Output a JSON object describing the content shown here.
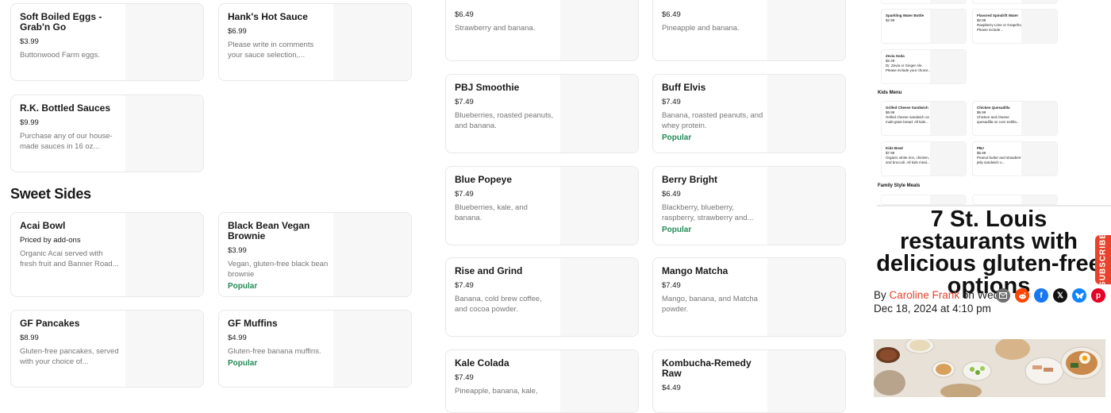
{
  "left_column": {
    "items": [
      {
        "name": "Soft Boiled Eggs - Grab'n Go",
        "price": "$3.99",
        "desc": "Buttonwood Farm eggs.",
        "popular": ""
      },
      {
        "name": "Hank's Hot Sauce",
        "price": "$6.99",
        "desc": "Please write in comments your sauce selection,...",
        "popular": ""
      },
      {
        "name": "R.K. Bottled Sauces",
        "price": "$9.99",
        "desc": "Purchase any of our house-made sauces in 16 oz...",
        "popular": ""
      }
    ],
    "section_title": "Sweet Sides",
    "sweet_sides": [
      {
        "name": "Acai Bowl",
        "price": "Priced by add-ons",
        "desc": "Organic Acai served with fresh fruit and Banner Road...",
        "popular": ""
      },
      {
        "name": "Black Bean Vegan Brownie",
        "price": "$3.99",
        "desc": "Vegan, gluten-free black bean brownie",
        "popular": "Popular"
      },
      {
        "name": "GF Pancakes",
        "price": "$8.99",
        "desc": "Gluten-free pancakes, served with your choice of...",
        "popular": ""
      },
      {
        "name": "GF Muffins",
        "price": "$4.99",
        "desc": "Gluten-free banana muffins.",
        "popular": "Popular"
      }
    ]
  },
  "middle_column": {
    "items": [
      {
        "name": "",
        "price": "$6.49",
        "desc": "Strawberry and banana.",
        "popular": ""
      },
      {
        "name": "",
        "price": "$6.49",
        "desc": "Pineapple and banana.",
        "popular": ""
      },
      {
        "name": "PBJ Smoothie",
        "price": "$7.49",
        "desc": "Blueberries, roasted peanuts, and banana.",
        "popular": ""
      },
      {
        "name": "Buff Elvis",
        "price": "$7.49",
        "desc": "Banana, roasted peanuts, and whey protein.",
        "popular": "Popular"
      },
      {
        "name": "Blue Popeye",
        "price": "$7.49",
        "desc": "Blueberries, kale, and banana.",
        "popular": ""
      },
      {
        "name": "Berry Bright",
        "price": "$6.49",
        "desc": "Blackberry, blueberry, raspberry, strawberry and...",
        "popular": "Popular"
      },
      {
        "name": "Rise and Grind",
        "price": "$7.49",
        "desc": "Banana, cold brew coffee, and cocoa powder.",
        "popular": ""
      },
      {
        "name": "Mango Matcha",
        "price": "$7.49",
        "desc": "Mango, banana, and Matcha powder.",
        "popular": ""
      },
      {
        "name": "Kale Colada",
        "price": "$7.49",
        "desc": "Pineapple, banana, kale,",
        "popular": ""
      },
      {
        "name": "Kombucha-Remedy Raw",
        "price": "$4.49",
        "desc": "",
        "popular": ""
      }
    ]
  },
  "mini_menu": {
    "drinks": [
      {
        "name": "Sparkling Water Bottle",
        "price": "$2.99",
        "desc": ""
      },
      {
        "name": "Flavored Spindrift Water",
        "price": "$2.99",
        "desc": "Raspberry Lime or Grapefruit. Please include..."
      },
      {
        "name": "Zevia Soda",
        "price": "$2.49",
        "desc": "Dr. Zevia or Ginger Ale. Please include your choice..."
      }
    ],
    "kids_title": "Kids Menu",
    "kids": [
      {
        "name": "Grilled Cheese Sandwich",
        "price": "$6.99",
        "desc": "Grilled cheese sandwich on multi-grain bread. All kids..."
      },
      {
        "name": "Chicken Quesadilla",
        "price": "$6.99",
        "desc": "Chicken and cheese quesadilla on corn tortilla..."
      },
      {
        "name": "Kids Bowl",
        "price": "$7.99",
        "desc": "Organic white rice, chicken, and broccoli. All kids meal..."
      },
      {
        "name": "PBJ",
        "price": "$5.99",
        "desc": "Peanut butter and strawberry jelly sandwich o..."
      }
    ],
    "family_title": "Family Style Meals"
  },
  "article": {
    "headline": "7 St. Louis restaurants with delicious gluten-free options",
    "by": "By",
    "author": "Caroline Frank",
    "date": "on Wed, Dec 18, 2024 at 4:10 pm",
    "subscribe": "SUBSCRIBE",
    "share_icons": [
      "email-icon",
      "reddit-icon",
      "facebook-icon",
      "x-icon",
      "bluesky-icon",
      "pinterest-icon"
    ],
    "colors": {
      "accent": "#e8422a",
      "popular": "#238a57"
    }
  }
}
